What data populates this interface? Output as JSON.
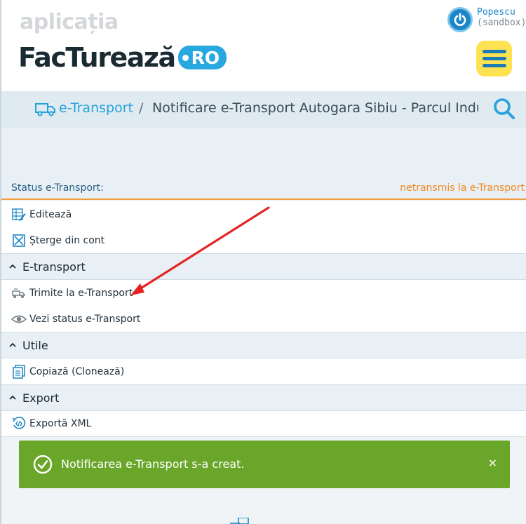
{
  "header": {
    "app_label": "aplicația",
    "logo_text": "FacTurează",
    "logo_suffix": "RO",
    "user_name": "Popescu",
    "user_env": "(sandbox)"
  },
  "breadcrumb": {
    "link": "e-Transport",
    "separator": "/",
    "current": "Notificare e-Transport Autogara Sibiu - Parcul Indust"
  },
  "status": {
    "label": "Status e-Transport:",
    "value": "netransmis la e-Transport"
  },
  "actions": {
    "edit": "Editează",
    "delete": "Șterge din cont",
    "section_etransport": "E-transport",
    "send": "Trimite la e-Transport",
    "view_status": "Vezi status e-Transport",
    "section_utile": "Utile",
    "copy": "Copiază (Clonează)",
    "section_export": "Export",
    "export_xml": "Exportă XML"
  },
  "toast": {
    "message": "Notificarea e-Transport s-a creat.",
    "close": "×"
  },
  "colors": {
    "accent_blue": "#27a3dc",
    "status_orange": "#f08a20",
    "toast_green": "#6aa629",
    "menu_yellow": "#ffe252"
  },
  "icons": [
    "power-icon",
    "menu-icon",
    "truck-icon",
    "search-icon",
    "edit-icon",
    "delete-icon",
    "chevron-up-icon",
    "send-truck-icon",
    "eye-icon",
    "copy-icon",
    "export-xml-icon",
    "checkmark-circle-icon",
    "close-icon"
  ]
}
